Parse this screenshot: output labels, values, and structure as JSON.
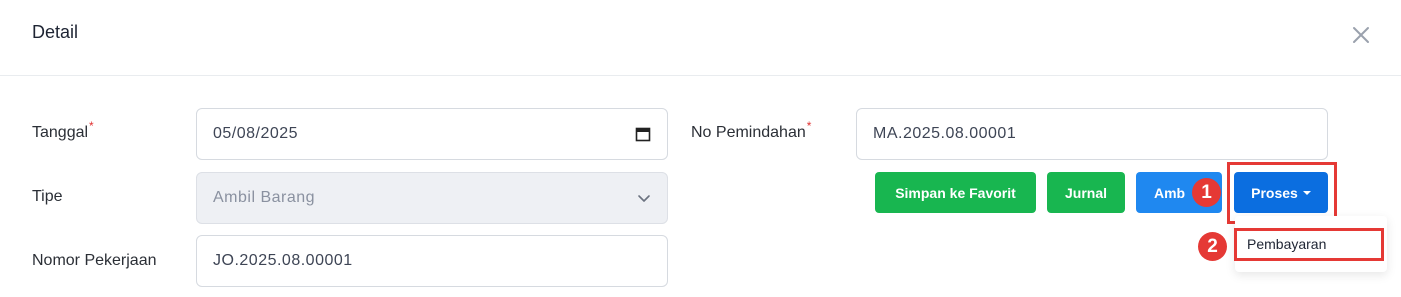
{
  "modal": {
    "title": "Detail",
    "close_icon": "close-icon"
  },
  "form": {
    "tanggal": {
      "label": "Tanggal",
      "required_mark": "*",
      "value": "05/08/2025",
      "icon": "calendar-icon"
    },
    "no_pemindahan": {
      "label": "No Pemindahan",
      "required_mark": "*",
      "value": "MA.2025.08.00001"
    },
    "tipe": {
      "label": "Tipe",
      "value": "Ambil Barang",
      "icon": "chevron-down-icon"
    },
    "nomor_pekerjaan": {
      "label": "Nomor Pekerjaan",
      "value": "JO.2025.08.00001"
    }
  },
  "actions": {
    "favorite_label": "Simpan ke Favorit",
    "jurnal_label": "Jurnal",
    "ambil_label": "Amb",
    "proses_label": "Proses"
  },
  "dropdown": {
    "items": [
      "Pembayaran"
    ]
  },
  "annotations": {
    "step1": "1",
    "step2": "2",
    "highlight_color": "#e53935"
  },
  "colors": {
    "green": "#18b650",
    "blue": "#1f88f0",
    "dark_blue": "#0b6ee0"
  }
}
